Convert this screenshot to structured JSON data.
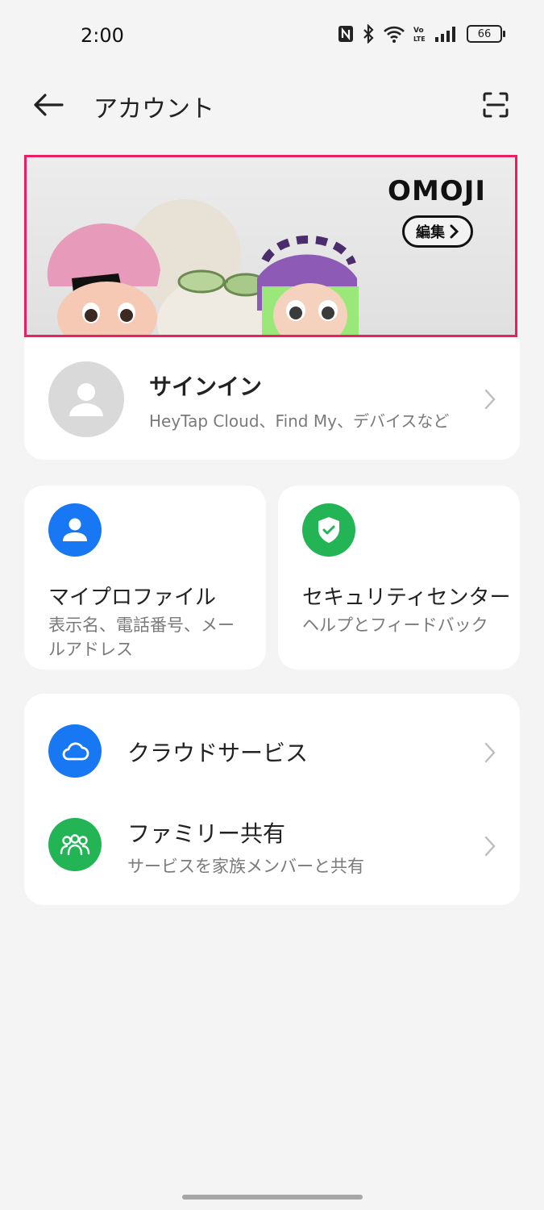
{
  "status_bar": {
    "time": "2:00",
    "battery": "66"
  },
  "header": {
    "title": "アカウント"
  },
  "banner": {
    "logo": "OMOJI",
    "edit_label": "編集"
  },
  "signin": {
    "title": "サインイン",
    "subtitle": "HeyTap Cloud、Find My、デバイスなど"
  },
  "profile_card": {
    "title": "マイプロファイル",
    "subtitle": "表示名、電話番号、メールアドレス"
  },
  "security_card": {
    "title": "セキュリティセンター",
    "subtitle": "ヘルプとフィードバック"
  },
  "services": {
    "cloud": {
      "title": "クラウドサービス"
    },
    "family": {
      "title": "ファミリー共有",
      "subtitle": "サービスを家族メンバーと共有"
    }
  },
  "colors": {
    "accent_blue": "#1877f2",
    "accent_green": "#22b455",
    "highlight_border": "#e91e63"
  }
}
